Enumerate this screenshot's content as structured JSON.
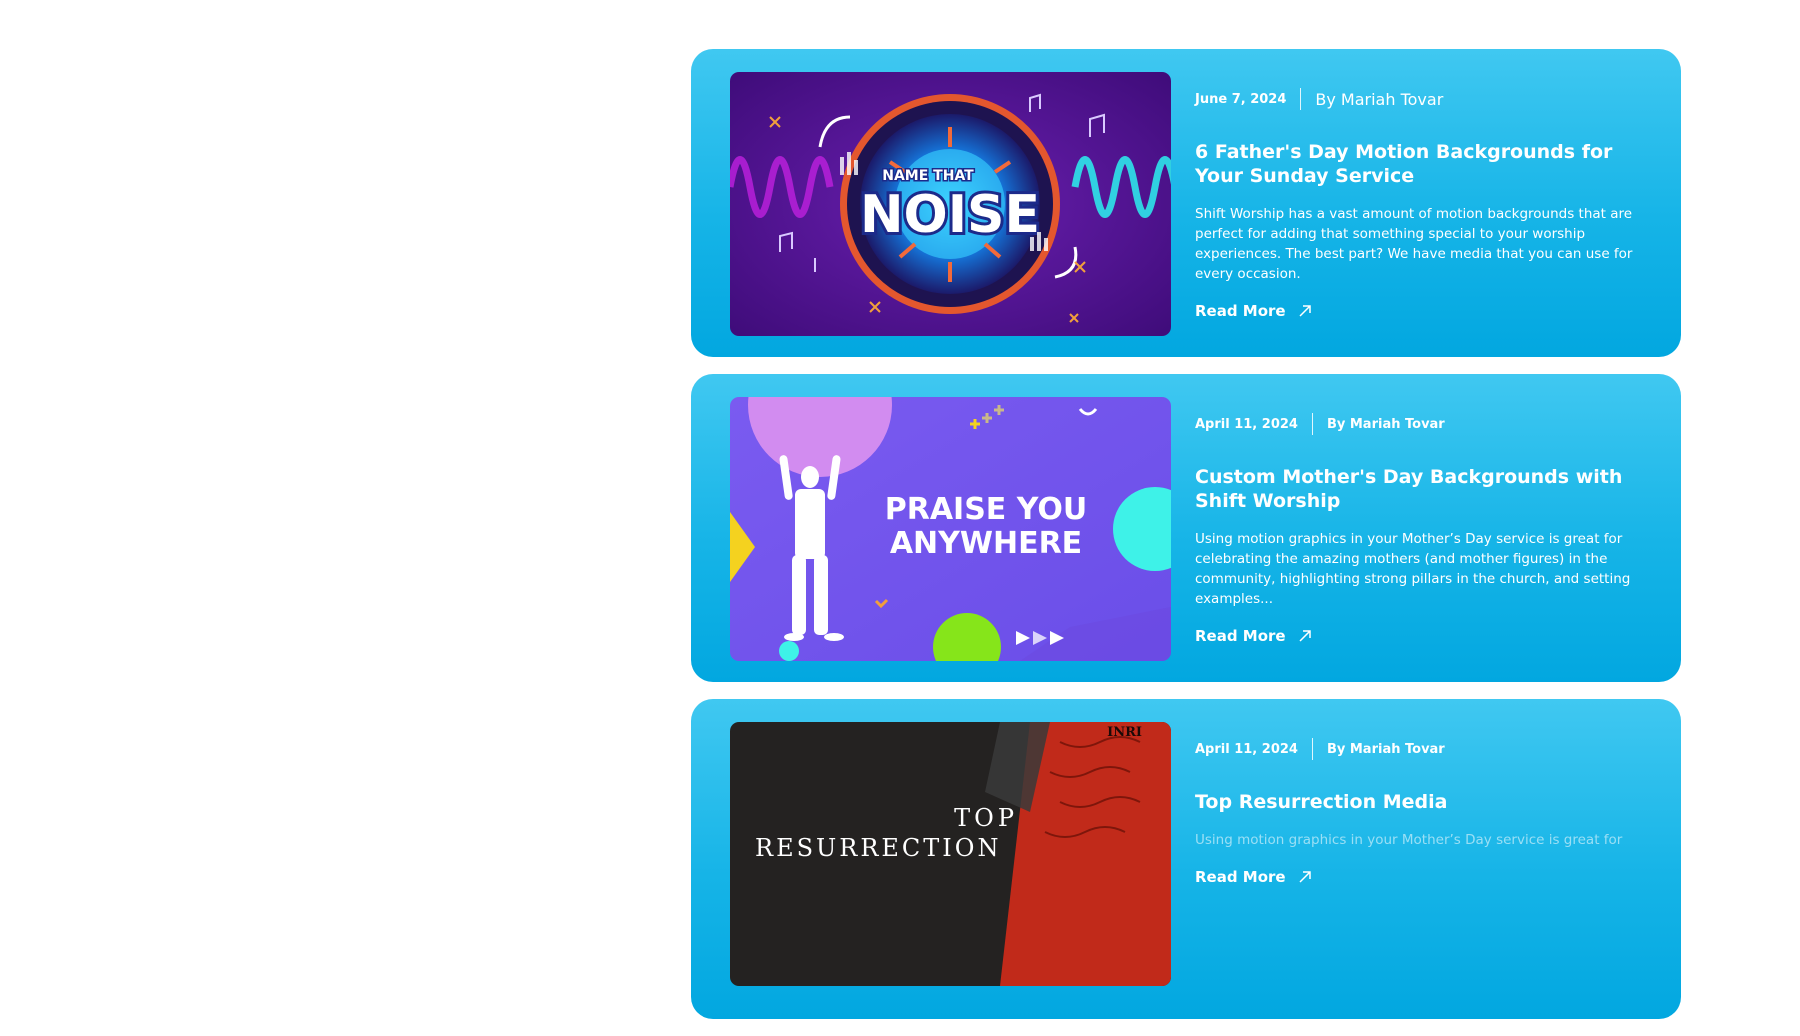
{
  "posts": [
    {
      "date": "June 7, 2024",
      "author": "By Mariah Tovar",
      "title": "6 Father's Day Motion Backgrounds for Your Sunday Service",
      "excerpt": "Shift Worship has a vast amount of motion backgrounds that are perfect for adding that something special to your worship experiences. The best part? We have media that you can use for every occasion.",
      "read_more": "Read More",
      "image_text": [
        "NAME THAT",
        "NOISE"
      ]
    },
    {
      "date": "April 11, 2024",
      "author": "By Mariah Tovar",
      "title": "Custom Mother's Day Backgrounds with Shift Worship",
      "excerpt": "Using motion graphics in your Mother’s Day service is great for celebrating the amazing mothers (and mother figures) in the community, highlighting strong pillars in the church, and setting examples...",
      "read_more": "Read More",
      "image_text": [
        "PRAISE YOU",
        "ANYWHERE"
      ]
    },
    {
      "date": "April 11, 2024",
      "author": "By Mariah Tovar",
      "title": "Top Resurrection Media",
      "excerpt": "Using motion graphics in your Mother’s Day service is great for",
      "read_more": "Read More",
      "image_text": [
        "TOP",
        "RESURRECTION"
      ]
    }
  ],
  "colors": {
    "card_top": "#40c8f1",
    "card_bottom": "#02a7e0",
    "text": "#ffffff"
  },
  "icons": {
    "read_more": "arrow-up-right-icon"
  }
}
